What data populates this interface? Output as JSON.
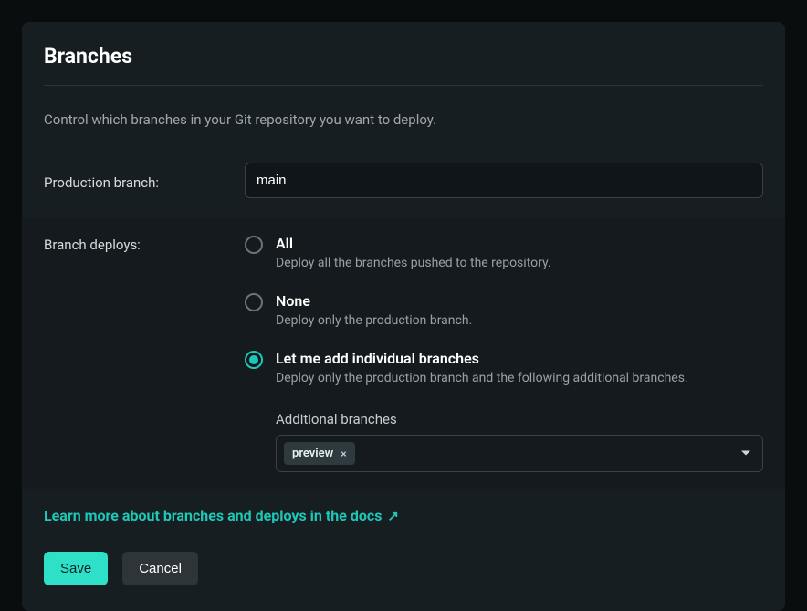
{
  "section": {
    "title": "Branches",
    "description": "Control which branches in your Git repository you want to deploy."
  },
  "form": {
    "production_label": "Production branch:",
    "production_value": "main",
    "deploys_label": "Branch deploys:",
    "options": {
      "all": {
        "title": "All",
        "subtitle": "Deploy all the branches pushed to the repository."
      },
      "none": {
        "title": "None",
        "subtitle": "Deploy only the production branch."
      },
      "individual": {
        "title": "Let me add individual branches",
        "subtitle": "Deploy only the production branch and the following additional branches."
      }
    },
    "selected_option": "individual",
    "additional_label": "Additional branches",
    "additional_branches": [
      "preview"
    ]
  },
  "links": {
    "docs": "Learn more about branches and deploys in the docs"
  },
  "buttons": {
    "save": "Save",
    "cancel": "Cancel"
  }
}
